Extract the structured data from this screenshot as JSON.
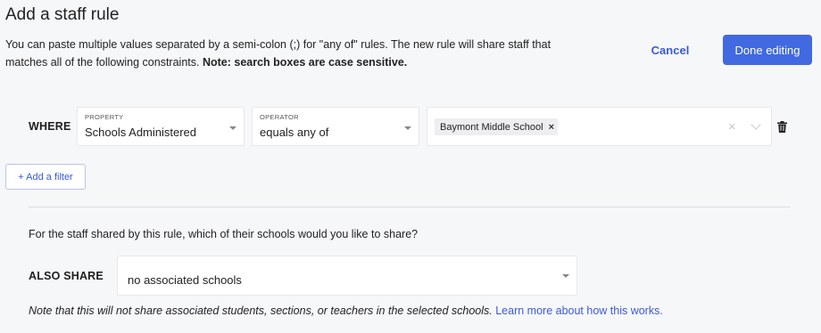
{
  "page": {
    "title": "Add a staff rule",
    "description_part1": "You can paste multiple values separated by a semi-colon (;) for \"any of\" rules. The new rule will share staff that matches all of the following constraints.",
    "description_bold": "Note: search boxes are case sensitive."
  },
  "actions": {
    "cancel_label": "Cancel",
    "done_label": "Done editing"
  },
  "filter": {
    "where_label": "WHERE",
    "property_label": "PROPERTY",
    "property_value": "Schools Administered",
    "operator_label": "OPERATOR",
    "operator_value": "equals any of",
    "values": [
      "Baymont Middle School"
    ],
    "chip_remove": "×",
    "clear_all": "×"
  },
  "add_filter": {
    "label": "+ Add a filter"
  },
  "share": {
    "question": "For the staff shared by this rule, which of their schools would you like to share?",
    "also_share_label": "ALSO SHARE",
    "selected_value": "no associated schools",
    "note_text": "Note that this will not share associated students, sections, or teachers in the selected schools.",
    "learn_more_link": "Learn more about how this works."
  },
  "colors": {
    "primary": "#4169e1",
    "link": "#3b5ad6",
    "background": "#f6f7f9"
  },
  "icons": {
    "trash": "trash-icon",
    "chevron": "chevron-down-icon",
    "clear": "close-icon"
  }
}
